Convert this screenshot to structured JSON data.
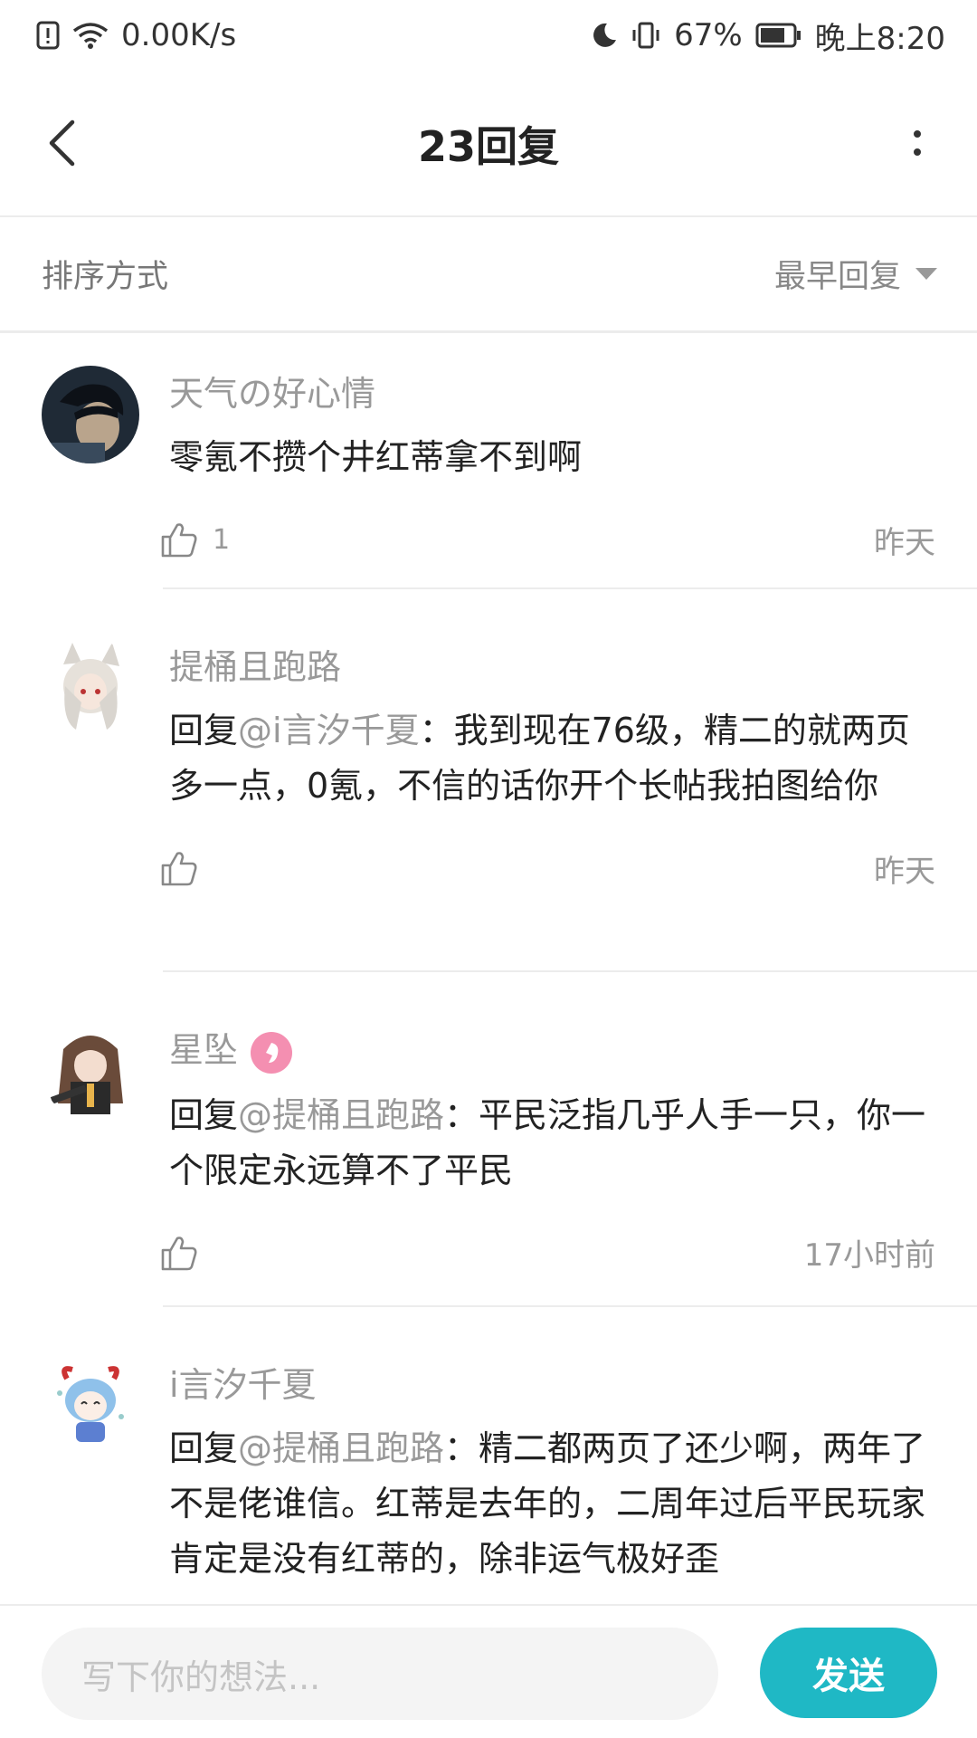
{
  "status_bar": {
    "net_speed": "0.00K/s",
    "battery": "67%",
    "time": "晚上8:20"
  },
  "header": {
    "title": "23回复"
  },
  "sort": {
    "label": "排序方式",
    "selected": "最早回复"
  },
  "comments": [
    {
      "name": "天气の好心情",
      "text": "零氪不攒个井红蒂拿不到啊",
      "likes": "1",
      "time": "昨天"
    },
    {
      "name": "提桶且跑路",
      "reply_prefix": "回复",
      "mention": "@i言汐千夏",
      "text": "：我到现在76级，精二的就两页多一点，0氪，不信的话你开个长帖我拍图给你",
      "likes": "",
      "time": "昨天"
    },
    {
      "name": "星坠",
      "reply_prefix": "回复",
      "mention": "@提桶且跑路",
      "text": "：平民泛指几乎人手一只，你一个限定永远算不了平民",
      "likes": "",
      "time": "17小时前"
    },
    {
      "name": "i言汐千夏",
      "reply_prefix": "回复",
      "mention": "@提桶且跑路",
      "text": "：精二都两页了还少啊，两年了不是佬谁信。红蒂是去年的，二周年过后平民玩家肯定是没有红蒂的，除非运气极好歪",
      "likes": "",
      "time": ""
    }
  ],
  "input": {
    "placeholder": "写下你的想法...",
    "send_label": "发送"
  },
  "colors": {
    "accent": "#1fb8c5",
    "muted_text": "#999999",
    "divider": "#ececec"
  }
}
